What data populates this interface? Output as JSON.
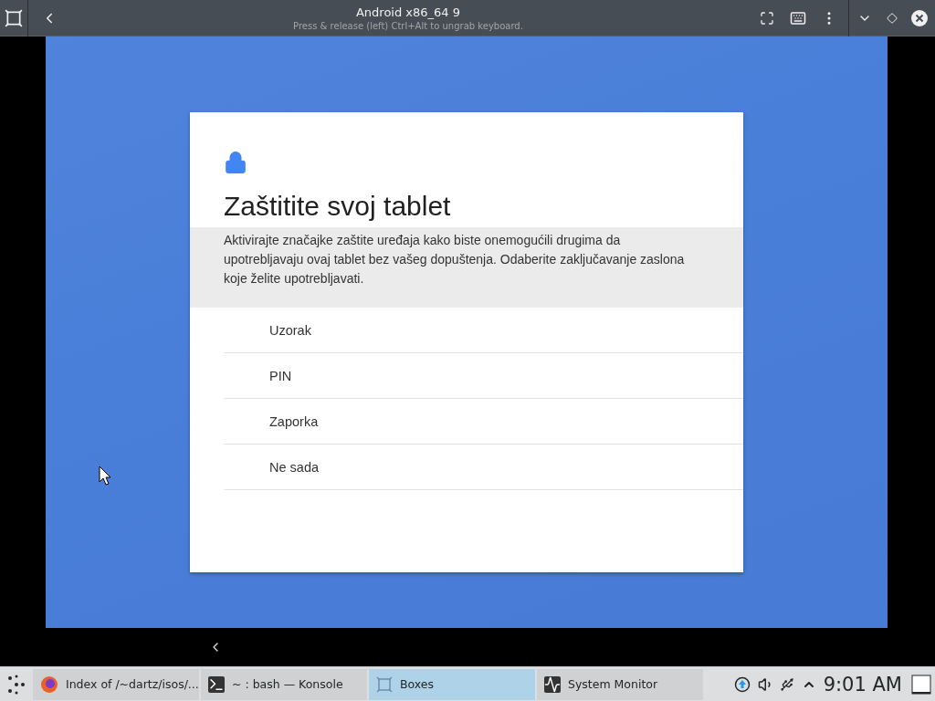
{
  "window": {
    "title": "Android x86_64 9",
    "subtitle": "Press & release (left) Ctrl+Alt to ungrab keyboard."
  },
  "setup": {
    "title": "Zaštitite svoj tablet",
    "description": "Aktivirajte značajke zaštite uređaja kako biste onemogućili drugima da upotrebljavaju ovaj tablet bez vašeg dopuštenja. Odaberite zaključavanje zaslona koje želite upotrebljavati.",
    "options": [
      "Uzorak",
      "PIN",
      "Zaporka",
      "Ne sada"
    ]
  },
  "taskbar": {
    "tasks": [
      {
        "kind": "browser",
        "label": "Index of /~dartz/isos/...",
        "selected": false
      },
      {
        "kind": "terminal",
        "label": "~ : bash — Konsole",
        "selected": false
      },
      {
        "kind": "boxes",
        "label": "Boxes",
        "selected": true
      },
      {
        "kind": "monitor",
        "label": "System Monitor",
        "selected": false
      }
    ],
    "clock": "9:01 AM"
  }
}
